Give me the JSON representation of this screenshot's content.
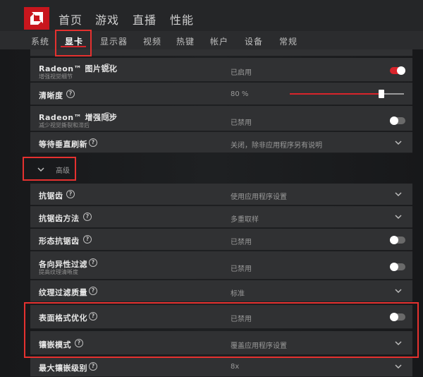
{
  "brand": {
    "logo": "amd-logo-icon",
    "accent": "#d8242b"
  },
  "top_nav": [
    "首页",
    "游戏",
    "直播",
    "性能"
  ],
  "sub_nav": {
    "items": [
      "系统",
      "显卡",
      "显示器",
      "视频",
      "热键",
      "帐户",
      "设备",
      "常规"
    ],
    "active": "显卡"
  },
  "settings": [
    {
      "label": "Radeon™ 图片锐化",
      "sub": "增强视觉细节",
      "value": "已启用",
      "control": "toggle",
      "on": true
    },
    {
      "label": "清晰度",
      "sub": "",
      "value": "80 %",
      "control": "slider",
      "level": 0.8
    },
    {
      "label": "Radeon™ 增强同步",
      "sub": "减少视觉撕裂和滞后",
      "value": "已禁用",
      "control": "toggle",
      "on": false
    },
    {
      "label": "等待垂直刷新",
      "sub": "",
      "value": "关闭，除非应用程序另有说明",
      "control": "dropdown"
    }
  ],
  "advanced": {
    "label": "高级",
    "expanded": true
  },
  "advanced_settings": [
    {
      "label": "抗锯齿",
      "sub": "",
      "value": "使用应用程序设置",
      "control": "dropdown"
    },
    {
      "label": "抗锯齿方法",
      "sub": "",
      "value": "多重取样",
      "control": "dropdown"
    },
    {
      "label": "形态抗锯齿",
      "sub": "",
      "value": "已禁用",
      "control": "toggle",
      "on": false
    },
    {
      "label": "各向异性过滤",
      "sub": "提高纹理清晰度",
      "value": "已禁用",
      "control": "toggle",
      "on": false
    },
    {
      "label": "纹理过滤质量",
      "sub": "",
      "value": "标准",
      "control": "dropdown"
    },
    {
      "label": "表面格式优化",
      "sub": "",
      "value": "已禁用",
      "control": "toggle",
      "on": false
    },
    {
      "label": "镶嵌模式",
      "sub": "",
      "value": "覆盖应用程序设置",
      "control": "dropdown"
    },
    {
      "label": "最大镶嵌级别",
      "sub": "",
      "value": "8x",
      "control": "dropdown"
    }
  ],
  "annotation_color": "#e5312f"
}
